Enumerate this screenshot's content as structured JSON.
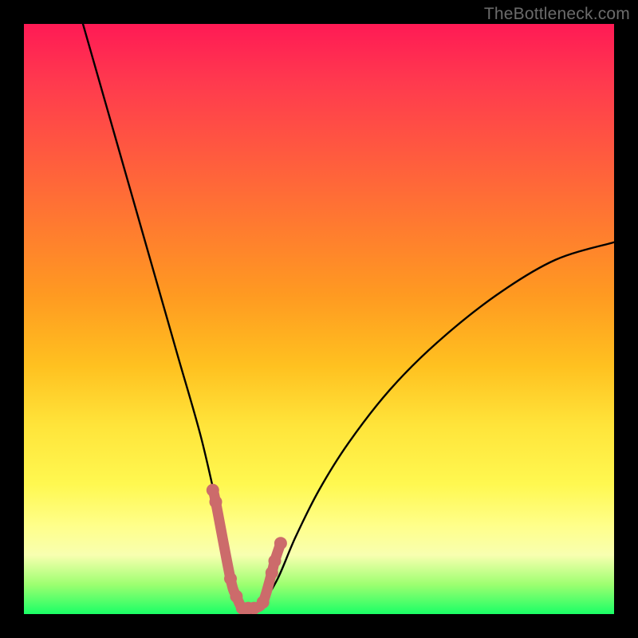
{
  "watermark": "TheBottleneck.com",
  "chart_data": {
    "type": "line",
    "title": "",
    "xlabel": "",
    "ylabel": "",
    "xlim": [
      0,
      100
    ],
    "ylim": [
      0,
      100
    ],
    "series": [
      {
        "name": "bottleneck-curve",
        "x": [
          10,
          14,
          18,
          22,
          26,
          30,
          33,
          35,
          36,
          37,
          38,
          39,
          40,
          43,
          46,
          50,
          55,
          62,
          70,
          80,
          90,
          100
        ],
        "values": [
          100,
          86,
          72,
          58,
          44,
          30,
          17,
          8,
          3,
          0,
          0,
          0,
          1,
          6,
          13,
          21,
          29,
          38,
          46,
          54,
          60,
          63
        ]
      }
    ],
    "markers": {
      "name": "highlight-dots",
      "x": [
        32,
        32.5,
        35,
        36,
        37,
        38,
        39,
        40.5,
        42,
        42.5,
        43.5
      ],
      "values": [
        21,
        19,
        6,
        3,
        1,
        1,
        1,
        2,
        7,
        9,
        12
      ],
      "color": "#cc6b6b"
    },
    "background_gradient": {
      "top": "#ff1a55",
      "mid": "#ffe43a",
      "bottom": "#1aff66"
    }
  }
}
